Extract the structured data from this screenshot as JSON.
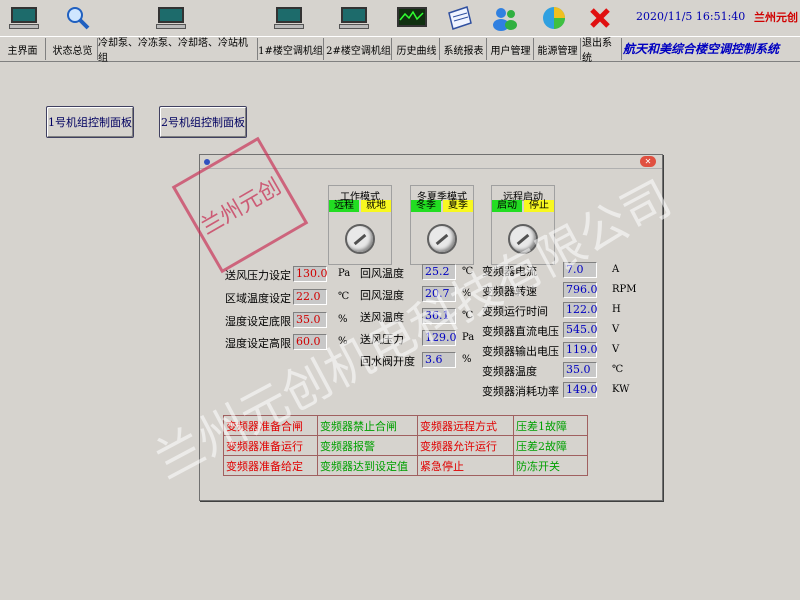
{
  "topbar": {
    "datetime": "2020/11/5 16:51:40",
    "brand": "兰州元创",
    "icons": [
      "monitor-icon",
      "magnifier-icon",
      "monitor-icon",
      "monitor-icon",
      "monitor-icon",
      "chart-monitor-icon",
      "report-icon",
      "users-icon",
      "pie-chart-icon",
      "close-x-icon"
    ]
  },
  "nav": {
    "items": [
      "主界面",
      "状态总览",
      "冷却泵、冷冻泵、冷却塔、冷站机组",
      "1#楼空调机组",
      "2#楼空调机组",
      "历史曲线",
      "系统报表",
      "用户管理",
      "能源管理",
      "退出系统"
    ],
    "system_name": "航天和美综合楼空调控制系统"
  },
  "buttons": {
    "unit1": "1号机组控制面板",
    "unit2": "2号机组控制面板"
  },
  "dialog": {
    "switches": [
      {
        "label": "工作模式",
        "on": "远程",
        "off": "就地"
      },
      {
        "label": "冬夏季模式",
        "on": "冬季",
        "off": "夏季"
      },
      {
        "label": "远程启动",
        "on": "启动",
        "off": "停止"
      }
    ],
    "setpoints": [
      {
        "label": "送风压力设定",
        "value": "130.0",
        "unit": "Pa"
      },
      {
        "label": "区域温度设定",
        "value": "22.0",
        "unit": "℃"
      },
      {
        "label": "湿度设定底限",
        "value": "35.0",
        "unit": "%"
      },
      {
        "label": "湿度设定高限",
        "value": "60.0",
        "unit": "%"
      }
    ],
    "readings": [
      {
        "label": "回风温度",
        "value": "25.2",
        "unit": "℃"
      },
      {
        "label": "回风湿度",
        "value": "20.7",
        "unit": "%"
      },
      {
        "label": "送风温度",
        "value": "36.1",
        "unit": "℃"
      },
      {
        "label": "送风压力",
        "value": "129.0",
        "unit": "Pa"
      },
      {
        "label": "回水阀开度",
        "value": "3.6",
        "unit": "%"
      }
    ],
    "vfd": [
      {
        "label": "变频器电流",
        "value": "7.0",
        "unit": "A"
      },
      {
        "label": "变频器转速",
        "value": "796.0",
        "unit": "RPM"
      },
      {
        "label": "变频运行时间",
        "value": "122.0",
        "unit": "H"
      },
      {
        "label": "变频器直流电压",
        "value": "545.0",
        "unit": "V"
      },
      {
        "label": "变频器输出电压",
        "value": "119.0",
        "unit": "V"
      },
      {
        "label": "变频器温度",
        "value": "35.0",
        "unit": "℃"
      },
      {
        "label": "变频器消耗功率",
        "value": "149.0",
        "unit": "KW"
      }
    ],
    "status": [
      [
        {
          "t": "变频器准备合闸",
          "c": "r"
        },
        {
          "t": "变频器禁止合闸",
          "c": "g"
        },
        {
          "t": "变频器远程方式",
          "c": "r"
        },
        {
          "t": "压差1故障",
          "c": "g"
        }
      ],
      [
        {
          "t": "变频器准备运行",
          "c": "r"
        },
        {
          "t": "变频器报警",
          "c": "g"
        },
        {
          "t": "变频器允许运行",
          "c": "r"
        },
        {
          "t": "压差2故障",
          "c": "g"
        }
      ],
      [
        {
          "t": "变频器准备给定",
          "c": "r"
        },
        {
          "t": "变频器达到设定值",
          "c": "g"
        },
        {
          "t": "紧急停止",
          "c": "r"
        },
        {
          "t": "防冻开关",
          "c": "g"
        }
      ]
    ]
  },
  "watermark": {
    "line1": "兰州元创机电科技有限公司",
    "stamp": "兰州元创"
  },
  "colors": {
    "background": "#d6d3ce",
    "on": "#22dd22",
    "off": "#f8f820",
    "alarm_red": "#e00000",
    "ok_green": "#00a000"
  }
}
